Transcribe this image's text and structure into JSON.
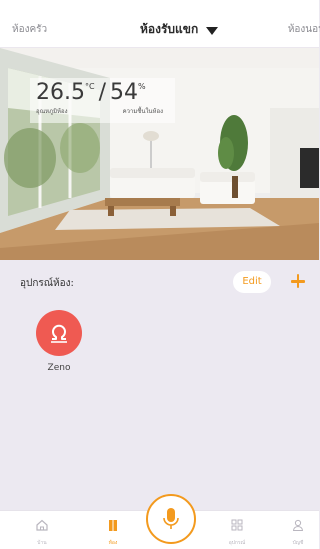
{
  "header": {
    "left_room": "ห้องครัว",
    "current_room": "ห้องรับแขก",
    "right_room": "ห้องนอน"
  },
  "readout": {
    "temperature": "26.5",
    "temperature_unit": "°C",
    "humidity": "54",
    "humidity_unit": "%",
    "temperature_label": "อุณหภูมิห้อง",
    "humidity_label": "ความชื้นในห้อง"
  },
  "devices": {
    "title": "อุปกรณ์ห้อง:",
    "edit_label": "Edit",
    "items": [
      {
        "name": "Zeno",
        "icon": "omega-device-icon",
        "color": "#ef5a52"
      }
    ]
  },
  "nav": {
    "items": [
      {
        "label": "บ้าน",
        "icon": "home-icon"
      },
      {
        "label": "ห้อง",
        "icon": "room-icon"
      },
      {
        "label": "",
        "icon": "microphone-icon"
      },
      {
        "label": "อุปกรณ์",
        "icon": "devices-grid-icon"
      },
      {
        "label": "บัญชี",
        "icon": "user-icon"
      }
    ]
  },
  "colors": {
    "accent": "#f39a1e",
    "device": "#ef5a52",
    "background": "#ece9f1"
  }
}
